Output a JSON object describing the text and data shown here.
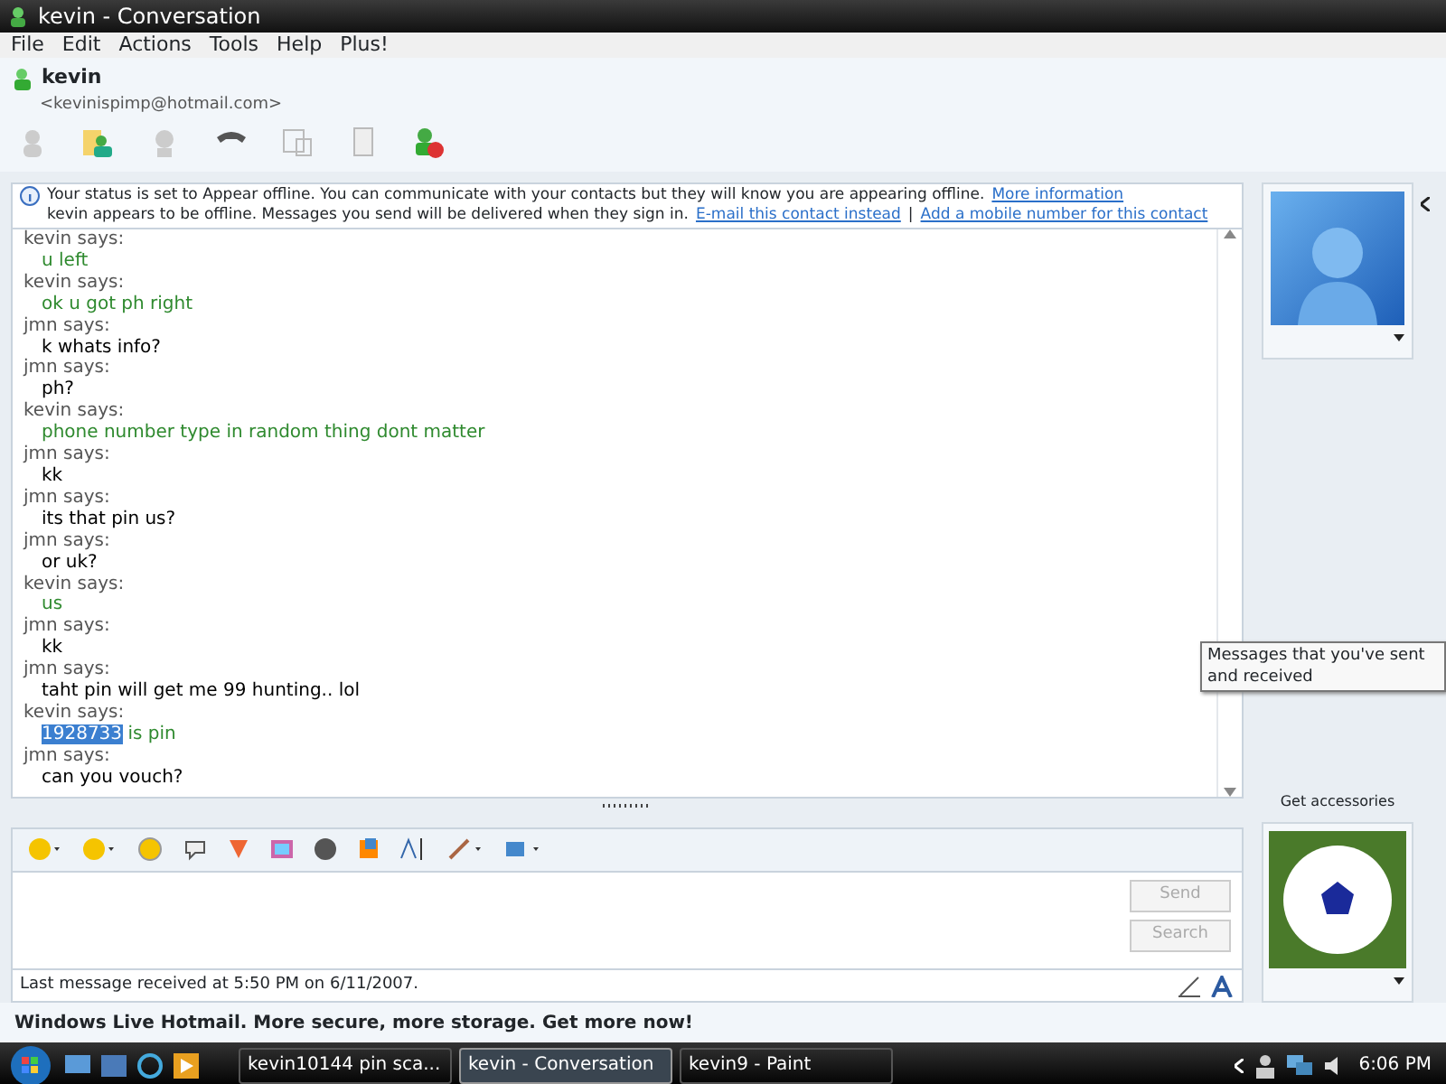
{
  "window": {
    "title": "kevin - Conversation"
  },
  "menu": [
    "File",
    "Edit",
    "Actions",
    "Tools",
    "Help",
    "Plus!"
  ],
  "contact": {
    "name": "kevin",
    "email": "<kevinispimp@hotmail.com>"
  },
  "info": {
    "line1": "Your status is set to Appear offline. You can communicate with your contacts but they will know you are appearing offline.",
    "link1": "More information",
    "line2": "kevin appears to be offline. Messages you send will be delivered when they sign in.",
    "link2": "E-mail this contact instead",
    "separator": "|",
    "link3": "Add a mobile number for this contact"
  },
  "messages": [
    {
      "sender": "kevin says:",
      "color": "#2f8a2f",
      "parts": [
        {
          "text": "u left",
          "selected": false
        }
      ]
    },
    {
      "sender": "kevin says:",
      "color": "#2f8a2f",
      "parts": [
        {
          "text": "ok u got ph right",
          "selected": false
        }
      ]
    },
    {
      "sender": "jmn says:",
      "color": "#000000",
      "parts": [
        {
          "text": "k whats info?",
          "selected": false
        }
      ]
    },
    {
      "sender": "jmn says:",
      "color": "#000000",
      "parts": [
        {
          "text": "ph?",
          "selected": false
        }
      ]
    },
    {
      "sender": "kevin says:",
      "color": "#2f8a2f",
      "parts": [
        {
          "text": "phone number type in random thing dont matter",
          "selected": false
        }
      ]
    },
    {
      "sender": "jmn says:",
      "color": "#000000",
      "parts": [
        {
          "text": "kk",
          "selected": false
        }
      ]
    },
    {
      "sender": "jmn says:",
      "color": "#000000",
      "parts": [
        {
          "text": "its that pin us?",
          "selected": false
        }
      ]
    },
    {
      "sender": "jmn says:",
      "color": "#000000",
      "parts": [
        {
          "text": "or uk?",
          "selected": false
        }
      ]
    },
    {
      "sender": "kevin says:",
      "color": "#2f8a2f",
      "parts": [
        {
          "text": "us",
          "selected": false
        }
      ]
    },
    {
      "sender": "jmn says:",
      "color": "#000000",
      "parts": [
        {
          "text": "kk",
          "selected": false
        }
      ]
    },
    {
      "sender": "jmn says:",
      "color": "#000000",
      "parts": [
        {
          "text": "taht pin will get me 99 hunting.. lol",
          "selected": false
        }
      ]
    },
    {
      "sender": "kevin says:",
      "color": "#2f8a2f",
      "parts": [
        {
          "text": "1928733",
          "selected": true
        },
        {
          "text": " is pin",
          "selected": false
        }
      ]
    },
    {
      "sender": "jmn says:",
      "color": "#000000",
      "parts": [
        {
          "text": "can you vouch?",
          "selected": false
        }
      ]
    }
  ],
  "tooltip": "Messages that you've sent and received",
  "accessories_label": "Get accessories",
  "buttons": {
    "send": "Send",
    "search": "Search"
  },
  "status_bar": "Last message received at 5:50 PM on 6/11/2007.",
  "ad": "Windows Live Hotmail. More secure, more storage. Get more now!",
  "taskbar": {
    "tasks": [
      {
        "label": "kevin10144 pin sca...",
        "selected": false
      },
      {
        "label": "kevin - Conversation",
        "selected": true
      },
      {
        "label": "kevin9 - Paint",
        "selected": false
      }
    ],
    "clock": "6:06 PM"
  }
}
